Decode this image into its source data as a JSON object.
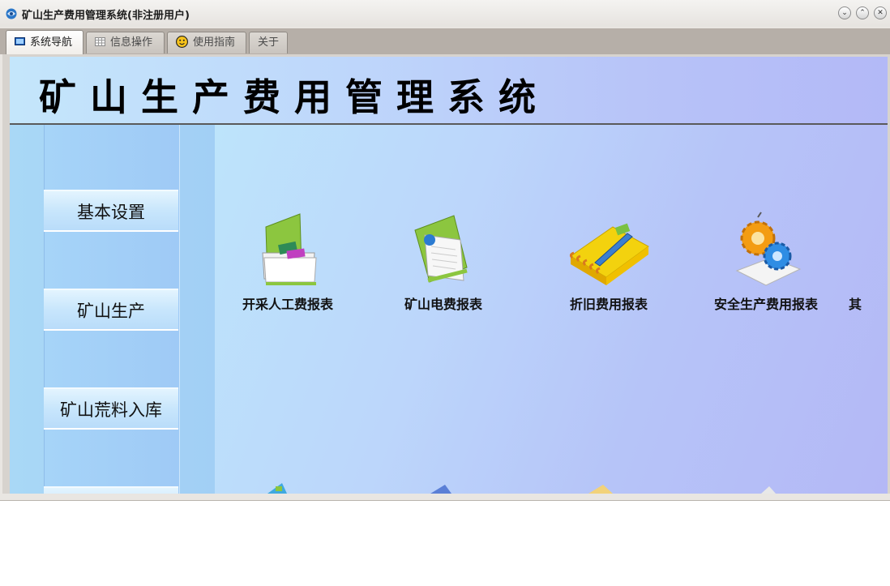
{
  "window": {
    "title": "矿山生产费用管理系统(非注册用户)",
    "controls": {
      "minimize": "⌄",
      "maximize": "⌃",
      "close": "✕"
    }
  },
  "tabs": [
    {
      "label": "系统导航",
      "icon": "monitor-icon",
      "active": true
    },
    {
      "label": "信息操作",
      "icon": "grid-icon",
      "active": false
    },
    {
      "label": "使用指南",
      "icon": "smiley-icon",
      "active": false
    },
    {
      "label": "关于",
      "icon": "",
      "active": false
    }
  ],
  "header": {
    "title": "矿山生产费用管理系统"
  },
  "sidebar": {
    "items": [
      {
        "label": "基本设置"
      },
      {
        "label": "矿山生产"
      },
      {
        "label": "矿山荒料入库"
      }
    ]
  },
  "tiles": [
    {
      "label": "开采人工费报表",
      "icon": "folder-documents-icon"
    },
    {
      "label": "矿山电费报表",
      "icon": "folder-paper-icon"
    },
    {
      "label": "折旧费用报表",
      "icon": "notebook-pencil-icon"
    },
    {
      "label": "安全生产费用报表",
      "icon": "gears-icon"
    },
    {
      "label": "其",
      "icon": "partial-icon"
    }
  ],
  "colors": {
    "accent": "#a6d4f8",
    "header_border": "#5a5a5a"
  }
}
